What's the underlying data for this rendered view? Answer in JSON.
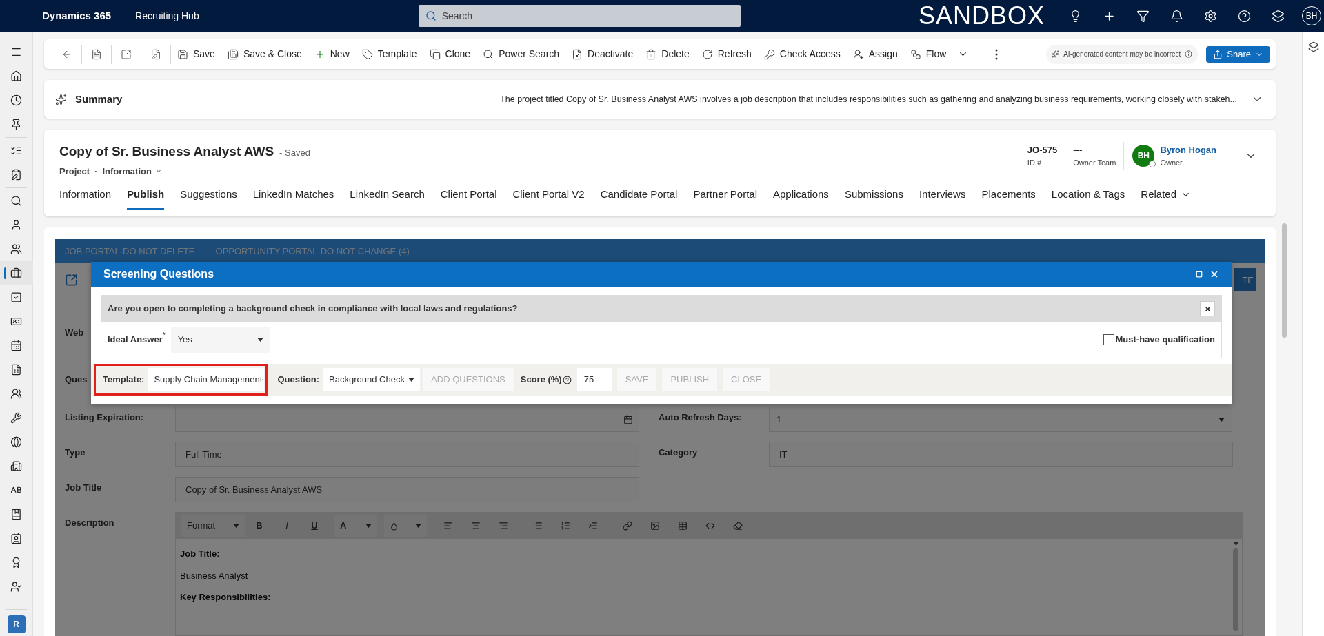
{
  "top_bar": {
    "app": "Dynamics 365",
    "area": "Recruiting Hub",
    "search": {
      "placeholder": "Search"
    },
    "environment": "SANDBOX",
    "avatar": "BH"
  },
  "sidebar": {
    "items": [
      {
        "kind": "menu",
        "selected": false
      },
      {
        "kind": "home",
        "selected": false
      },
      {
        "kind": "recent",
        "selected": false
      },
      {
        "kind": "pinned",
        "selected": false
      },
      {
        "kind": "checklist",
        "selected": false
      },
      {
        "kind": "clipboard",
        "selected": false
      },
      {
        "kind": "search",
        "selected": false
      },
      {
        "kind": "user",
        "selected": false
      },
      {
        "kind": "users",
        "selected": false
      },
      {
        "kind": "briefcase",
        "selected": true
      },
      {
        "kind": "task",
        "selected": false
      },
      {
        "kind": "card",
        "selected": false
      },
      {
        "kind": "calendar",
        "selected": false
      },
      {
        "kind": "sheet",
        "selected": false
      },
      {
        "kind": "group",
        "selected": false
      },
      {
        "kind": "tools",
        "selected": false
      },
      {
        "kind": "globe",
        "selected": false
      },
      {
        "kind": "building",
        "selected": false
      },
      {
        "kind": "letters",
        "selected": false
      },
      {
        "kind": "book",
        "selected": false
      },
      {
        "kind": "contact",
        "selected": false
      },
      {
        "kind": "award",
        "selected": false
      },
      {
        "kind": "user_check",
        "selected": false
      }
    ],
    "area_badge": "R"
  },
  "command_bar": {
    "items": [
      {
        "kind": "back"
      },
      {
        "kind": "form"
      },
      {
        "kind": "popout"
      },
      {
        "kind": "note"
      },
      {
        "kind": "save",
        "label": "Save"
      },
      {
        "kind": "save_close",
        "label": "Save & Close"
      },
      {
        "kind": "new",
        "label": "New"
      },
      {
        "kind": "template",
        "label": "Template"
      },
      {
        "kind": "clone",
        "label": "Clone"
      },
      {
        "kind": "power_search",
        "label": "Power Search"
      },
      {
        "kind": "deactivate",
        "label": "Deactivate"
      },
      {
        "kind": "delete",
        "label": "Delete"
      },
      {
        "kind": "refresh",
        "label": "Refresh"
      },
      {
        "kind": "check_access",
        "label": "Check Access"
      },
      {
        "kind": "assign",
        "label": "Assign"
      },
      {
        "kind": "flow",
        "label": "Flow"
      },
      {
        "kind": "more"
      }
    ],
    "ai_note": "AI-generated content may be incorrect",
    "share": "Share"
  },
  "summary": {
    "title": "Summary",
    "text": "The project titled Copy of Sr. Business Analyst AWS involves a job description that includes responsibilities such as gathering and analyzing business requirements, working closely with stakeh..."
  },
  "record": {
    "title": "Copy of Sr. Business Analyst AWS",
    "status": "- Saved",
    "entity": "Project",
    "separator": "·",
    "form": "Information",
    "fields": [
      {
        "value": "JO-575",
        "label": "ID #"
      },
      {
        "value": "---",
        "label": "Owner Team"
      }
    ],
    "owner": {
      "initials": "BH",
      "name": "Byron Hogan",
      "label": "Owner"
    },
    "tabs": [
      {
        "label": "Information",
        "selected": false
      },
      {
        "label": "Publish",
        "selected": true
      },
      {
        "label": "Suggestions",
        "selected": false
      },
      {
        "label": "LinkedIn Matches",
        "selected": false
      },
      {
        "label": "LinkedIn Search",
        "selected": false
      },
      {
        "label": "Client Portal",
        "selected": false
      },
      {
        "label": "Client Portal V2",
        "selected": false
      },
      {
        "label": "Candidate Portal",
        "selected": false
      },
      {
        "label": "Partner Portal",
        "selected": false
      },
      {
        "label": "Applications",
        "selected": false
      },
      {
        "label": "Submissions",
        "selected": false
      },
      {
        "label": "Interviews",
        "selected": false
      },
      {
        "label": "Placements",
        "selected": false
      },
      {
        "label": "Location & Tags",
        "selected": false
      },
      {
        "label": "Related",
        "selected": false
      }
    ]
  },
  "form": {
    "portal_tabs": [
      "JOB PORTAL-DO NOT DELETE",
      "OPPORTUNITY PORTAL-DO NOT CHANGE (4)"
    ],
    "action_button": "TE",
    "cut_labels": [
      "Web",
      "Ques"
    ],
    "rows": [
      [
        {
          "label": "Listing Expiration:",
          "kind": "date"
        },
        {
          "label": "Auto Refresh Days:",
          "kind": "select",
          "value": "1"
        }
      ],
      [
        {
          "label": "Type",
          "kind": "text",
          "value": "Full Time"
        },
        {
          "label": "Category",
          "kind": "text",
          "value": "IT"
        }
      ],
      [
        {
          "label": "Job Title",
          "kind": "text",
          "value": "Copy of Sr. Business Analyst AWS"
        }
      ]
    ],
    "description": {
      "label": "Description",
      "format": "Format",
      "text_buttons": [
        "B",
        "I",
        "U",
        "A"
      ],
      "paragraphs": [
        {
          "text": "Job Title:",
          "bold": true
        },
        {
          "text": "Business Analyst",
          "bold": false
        },
        {
          "text": "Key Responsibilities:",
          "bold": true
        }
      ]
    }
  },
  "dialog": {
    "title": "Screening Questions",
    "question": "Are you open to completing a background check in compliance with local laws and regulations?",
    "ideal_answer": {
      "label": "Ideal Answer",
      "required": "*",
      "value": "Yes"
    },
    "must_have": {
      "label": "Must-have qualification",
      "checked": false
    },
    "template": {
      "label": "Template:",
      "value": "Supply Chain Management",
      "highlighted": true
    },
    "question_select": {
      "label": "Question:",
      "value": "Background Check"
    },
    "add_button": {
      "label": "ADD QUESTIONS",
      "disabled": true
    },
    "score": {
      "label": "Score (%)",
      "value": "75"
    },
    "buttons": [
      {
        "label": "SAVE",
        "disabled": true
      },
      {
        "label": "PUBLISH",
        "disabled": true
      },
      {
        "label": "CLOSE",
        "disabled": true
      }
    ]
  }
}
